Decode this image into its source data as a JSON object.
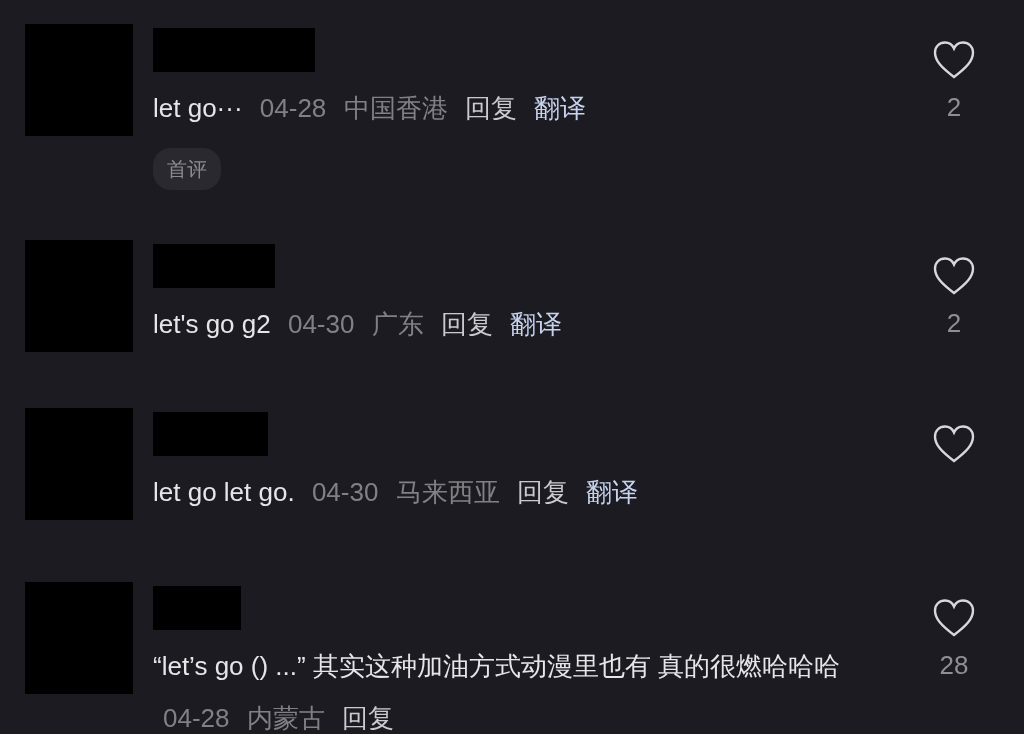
{
  "comments": [
    {
      "text": "let go···",
      "date": "04-28",
      "location": "中国香港",
      "reply": "回复",
      "translate": "翻译",
      "badge": "首评",
      "liked": false,
      "likes": "2"
    },
    {
      "text": "let's go g2",
      "date": "04-30",
      "location": "广东",
      "reply": "回复",
      "translate": "翻译",
      "liked": false,
      "likes": "2"
    },
    {
      "text": "let go let go.",
      "date": "04-30",
      "location": "马来西亚",
      "reply": "回复",
      "translate": "翻译",
      "liked": false
    },
    {
      "text": "“let’s go () ...” 其实这种加油方式动漫里也有 真的很燃哈哈哈",
      "date": "04-28",
      "location": "内蒙古",
      "reply": "回复",
      "liked": false,
      "likes": "28"
    }
  ]
}
